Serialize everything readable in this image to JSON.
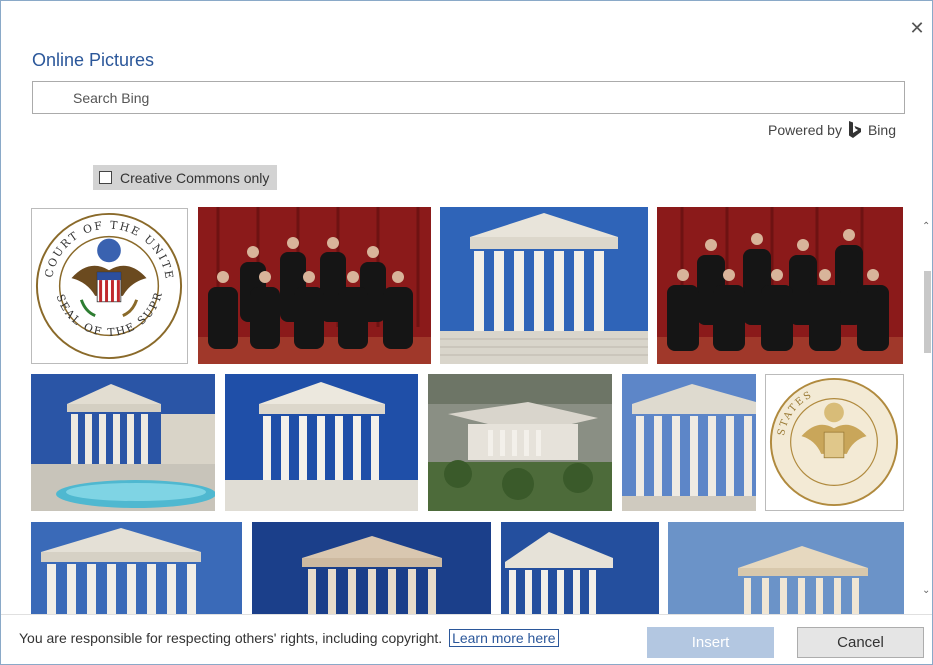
{
  "dialog": {
    "title": "Online Pictures",
    "close_label": "✕"
  },
  "search": {
    "placeholder": "Search Bing",
    "value": ""
  },
  "powered_by": {
    "text": "Powered by",
    "brand": "Bing"
  },
  "filter": {
    "creative_commons_label": "Creative Commons only",
    "checked": false
  },
  "results": {
    "thumbnails": [
      {
        "subject": "supreme-court-seal",
        "row": 1
      },
      {
        "subject": "justices-group-photo",
        "row": 1
      },
      {
        "subject": "supreme-court-building",
        "row": 1
      },
      {
        "subject": "justices-group-photo",
        "row": 1
      },
      {
        "subject": "supreme-court-building-fountain",
        "row": 2
      },
      {
        "subject": "supreme-court-building",
        "row": 2
      },
      {
        "subject": "supreme-court-aerial",
        "row": 2
      },
      {
        "subject": "supreme-court-building-side",
        "row": 2
      },
      {
        "subject": "supreme-court-seal-gold",
        "row": 2
      },
      {
        "subject": "supreme-court-building",
        "row": 3
      },
      {
        "subject": "supreme-court-building",
        "row": 3
      },
      {
        "subject": "supreme-court-building",
        "row": 3
      },
      {
        "subject": "supreme-court-building",
        "row": 3
      }
    ]
  },
  "seal_text": {
    "top": "COURT OF THE UNITED",
    "bottom": "SEAL OF THE SUPREME",
    "right": "STATES"
  },
  "footer": {
    "notice": "You are responsible for respecting others' rights, including copyright.",
    "learn_more": "Learn more here",
    "insert_label": "Insert",
    "cancel_label": "Cancel"
  },
  "colors": {
    "title": "#2b579a",
    "insert_button": "#b3c7e1",
    "sky": "#2f64b8",
    "curtain": "#8b1a1a"
  }
}
